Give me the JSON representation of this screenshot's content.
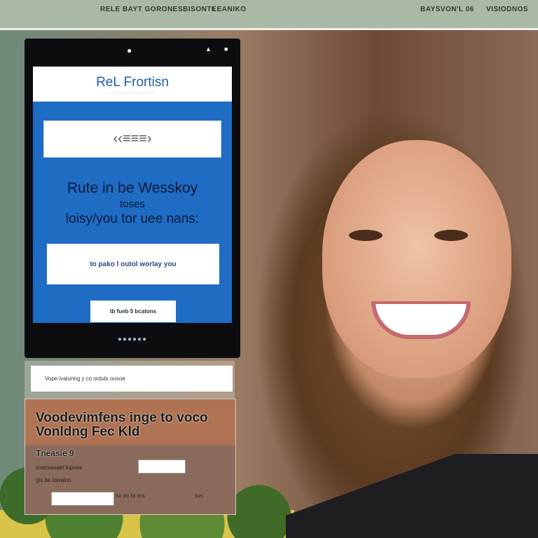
{
  "topbar": {
    "nav_left": "RELE  BAYT GORONESBISONTE",
    "nav_mid": "LEANIKO",
    "nav_right1": "BAYSVON'L 06",
    "nav_right2": "VISIODNOS"
  },
  "phone": {
    "app_title": "ReL Frortisn",
    "app_subtitle": "...........................",
    "logo_glyph": "‹‹≡≡≡›",
    "headline_1": "Rute in be Wesskoy",
    "headline_2": "toses",
    "headline_3": "loisy/you tor uee nans:",
    "cta_text": "to pako l outol worlay you",
    "button_text": "tb fueb 5 bcatons",
    "dots": "●●●●●●"
  },
  "panel": {
    "search_text": "Vope ivaiunng y co ootuls ousoe",
    "title_line1": "Voodevimfens  inge to voco",
    "title_line2": "Vonldng Fec Kld",
    "label": "Tneasie 9",
    "line1": "cnacvasaet lopoes",
    "line2": "gis be lowalon",
    "mini_text_1": "Ko slo lol ons",
    "mini_text_2": "kus"
  },
  "colors": {
    "brand_blue": "#1e6cc4",
    "topbar": "#a9b9a5"
  }
}
